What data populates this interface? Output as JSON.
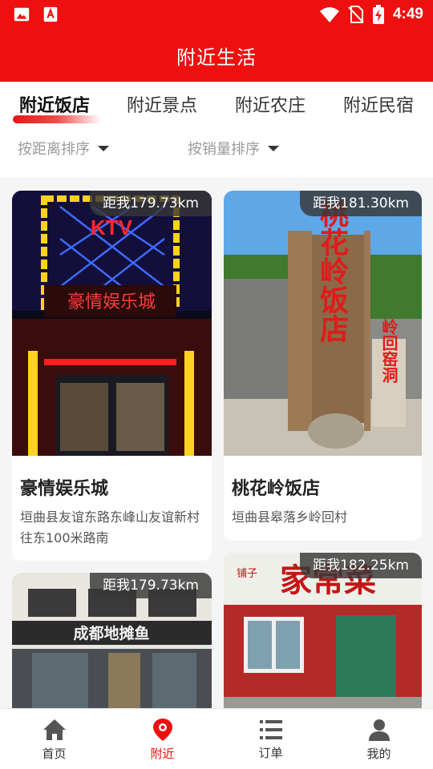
{
  "status_bar": {
    "time": "4:49",
    "left_icons": [
      "image-icon",
      "app-a-icon"
    ],
    "right_icons": [
      "wifi-icon",
      "no-sim-icon",
      "battery-charging-icon"
    ]
  },
  "header": {
    "title": "附近生活"
  },
  "tabs": [
    {
      "label": "附近饭店",
      "active": true
    },
    {
      "label": "附近景点",
      "active": false
    },
    {
      "label": "附近农庄",
      "active": false
    },
    {
      "label": "附近民宿",
      "active": false
    }
  ],
  "sort": {
    "distance_label": "按距离排序",
    "sales_label": "按销量排序"
  },
  "cards": [
    {
      "distance": "距我179.73km",
      "name": "豪情娱乐城",
      "address": "垣曲县友谊东路东峰山友谊新村往东100米路南",
      "sign_text": "KTV",
      "sign_sub": "豪情娱乐城"
    },
    {
      "distance": "距我181.30km",
      "name": "桃花岭饭店",
      "address": "垣曲县皋落乡岭回村",
      "sign_text": "桃花岭饭店",
      "sign_sub": "岭回窑洞"
    },
    {
      "distance": "距我179.73km",
      "sign_text": "成都地摊鱼"
    },
    {
      "distance": "距我182.25km",
      "sign_text": "家常菜",
      "sign_sub": "铺子"
    }
  ],
  "bottom_nav": [
    {
      "label": "首页",
      "icon": "home-icon",
      "active": false
    },
    {
      "label": "附近",
      "icon": "location-pin-icon",
      "active": true
    },
    {
      "label": "订单",
      "icon": "list-icon",
      "active": false
    },
    {
      "label": "我的",
      "icon": "user-icon",
      "active": false
    }
  ],
  "colors": {
    "brand_red": "#ee0f0f",
    "muted_text": "#9a9a9a"
  }
}
